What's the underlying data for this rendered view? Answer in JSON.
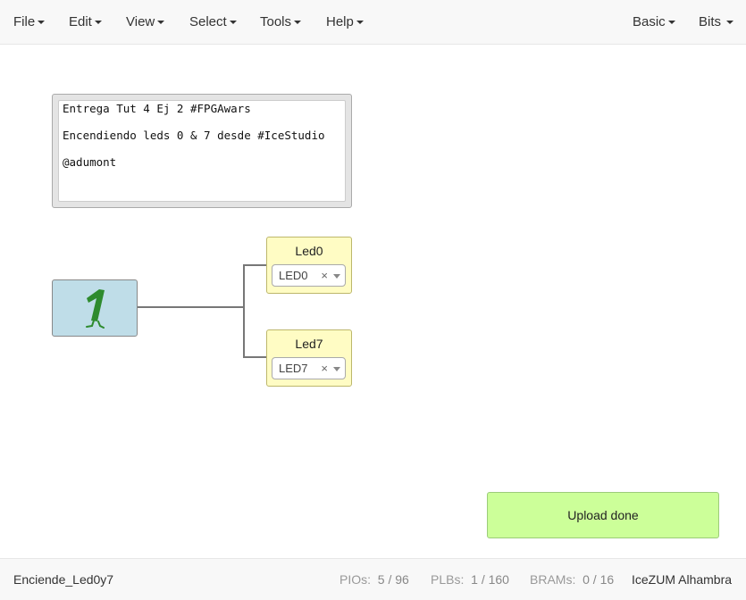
{
  "menu": {
    "file": "File",
    "edit": "Edit",
    "view": "View",
    "select": "Select",
    "tools": "Tools",
    "help": "Help",
    "basic": "Basic",
    "bits": "Bits"
  },
  "info_block": {
    "lines": [
      "Entrega Tut 4 Ej 2 #FPGAwars",
      "Encendiendo leds 0 & 7 desde #IceStudio",
      "@adumont"
    ]
  },
  "constant_block": {
    "icon": "constant-one-icon"
  },
  "outputs": [
    {
      "title": "Led0",
      "pin": "LED0",
      "clear": "×"
    },
    {
      "title": "Led7",
      "pin": "LED7",
      "clear": "×"
    }
  ],
  "toast": {
    "message": "Upload done"
  },
  "footer": {
    "project_name": "Enciende_Led0y7",
    "pios_label": "PIOs:",
    "pios_value": "5 / 96",
    "plbs_label": "PLBs:",
    "plbs_value": "1 / 160",
    "brams_label": "BRAMs:",
    "brams_value": "0 / 16",
    "board": "IceZUM Alhambra"
  },
  "colors": {
    "constant_block_bg": "#bfdde8",
    "output_block_bg": "#fffcc4",
    "toast_bg": "#ccff99",
    "constant_glyph": "#2e8b2e"
  }
}
